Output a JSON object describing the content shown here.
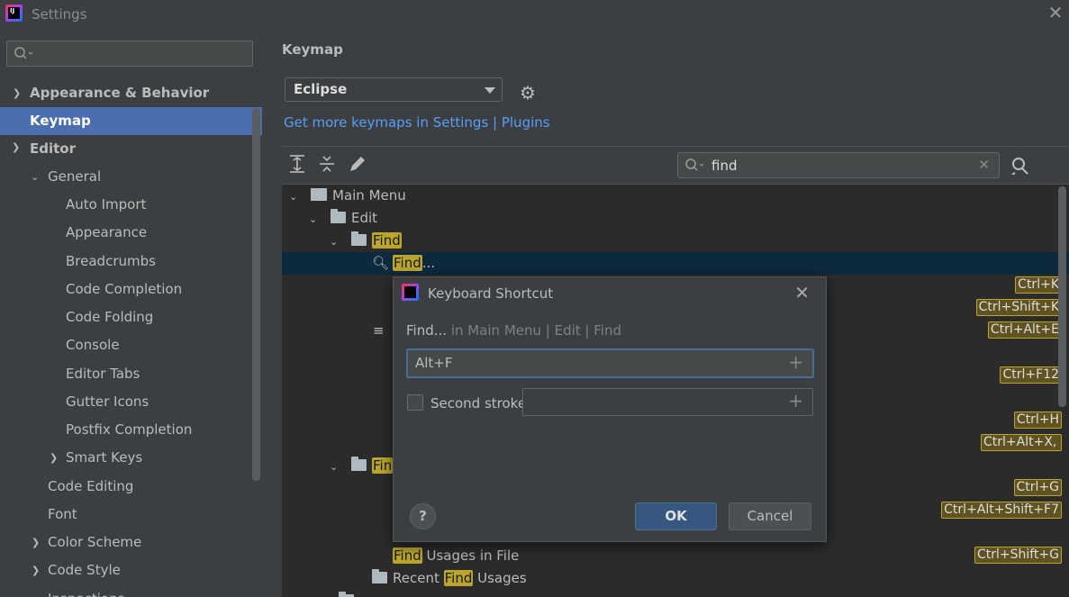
{
  "window": {
    "title": "Settings"
  },
  "sidebar": {
    "search_placeholder": "",
    "items": [
      {
        "label": "Appearance & Behavior",
        "arrow": "›"
      },
      {
        "label": "Keymap"
      },
      {
        "label": "Editor",
        "arrow": "⌄"
      },
      {
        "label": "General",
        "arrow": "⌄"
      },
      {
        "label": "Auto Import"
      },
      {
        "label": "Appearance"
      },
      {
        "label": "Breadcrumbs"
      },
      {
        "label": "Code Completion"
      },
      {
        "label": "Code Folding"
      },
      {
        "label": "Console"
      },
      {
        "label": "Editor Tabs"
      },
      {
        "label": "Gutter Icons"
      },
      {
        "label": "Postfix Completion"
      },
      {
        "label": "Smart Keys",
        "arrow": "›"
      },
      {
        "label": "Code Editing"
      },
      {
        "label": "Font"
      },
      {
        "label": "Color Scheme",
        "arrow": "›"
      },
      {
        "label": "Code Style",
        "arrow": "›"
      },
      {
        "label": "Inspections"
      }
    ]
  },
  "keymap": {
    "title": "Keymap",
    "selected_keymap": "Eclipse",
    "link": "Get more keymaps in Settings | Plugins",
    "filter_value": "find",
    "tree": {
      "main_menu": "Main Menu",
      "edit": "Edit",
      "find_folder": "Find",
      "find_action": "Find",
      "find_action_suffix": "...",
      "fin_folder2": "Fin",
      "find_usages_file_hl": "Find",
      "find_usages_file_rest": " Usages in File",
      "recent_prefix": "Recent ",
      "recent_hl": "Find",
      "recent_suffix": " Usages"
    },
    "shortcuts": [
      "Ctrl+K",
      "Ctrl+Shift+K",
      "Ctrl+Alt+E",
      "Ctrl+F12",
      "Ctrl+H",
      "Ctrl+Alt+X, F",
      "Ctrl+G",
      "Ctrl+Alt+Shift+F7",
      "Ctrl+Shift+G"
    ]
  },
  "dialog": {
    "title": "Keyboard Shortcut",
    "action": "Find...",
    "path": " in Main Menu | Edit | Find",
    "first_stroke": "Alt+F",
    "second_stroke_label": "Second stroke:",
    "second_stroke_value": "",
    "help": "?",
    "ok": "OK",
    "cancel": "Cancel"
  }
}
